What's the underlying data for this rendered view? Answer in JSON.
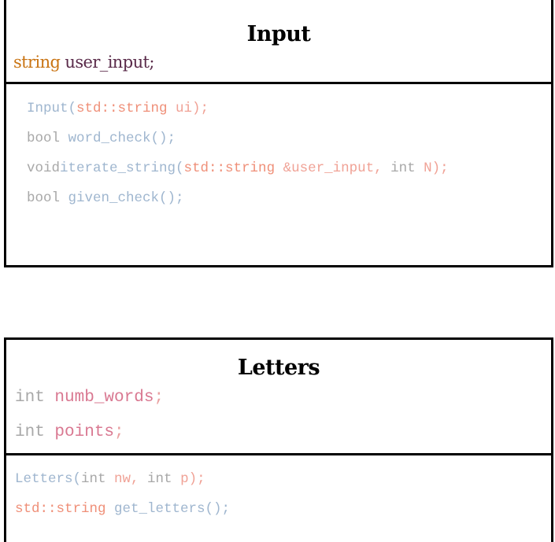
{
  "input_class": {
    "title": "Input",
    "attribute": {
      "type": "string",
      "name": "user_input;"
    },
    "methods": [
      {
        "segments": [
          {
            "text": "Input(",
            "style": "fn"
          },
          {
            "text": "std::string",
            "style": "type"
          },
          {
            "text": " ui);",
            "style": "arg"
          }
        ]
      },
      {
        "segments": [
          {
            "text": "bool",
            "style": "kw"
          },
          {
            "text": " word_check();",
            "style": "fn"
          }
        ]
      },
      {
        "segments": [
          {
            "text": "void",
            "style": "kw"
          },
          {
            "text": "iterate_string(",
            "style": "fn"
          },
          {
            "text": "std::string",
            "style": "type"
          },
          {
            "text": " &user_input, ",
            "style": "arg"
          },
          {
            "text": "int",
            "style": "kw"
          },
          {
            "text": " N);",
            "style": "arg"
          }
        ]
      },
      {
        "segments": [
          {
            "text": "bool",
            "style": "kw"
          },
          {
            "text": " given_check();",
            "style": "fn"
          }
        ]
      }
    ]
  },
  "letters_class": {
    "title": "Letters",
    "attributes": [
      {
        "segments": [
          {
            "text": "int",
            "style": "kw"
          },
          {
            "text": " numb_words",
            "style": "fieldname"
          },
          {
            "text": ";",
            "style": "punct"
          }
        ]
      },
      {
        "segments": [
          {
            "text": "int",
            "style": "kw"
          },
          {
            "text": " points",
            "style": "fieldname"
          },
          {
            "text": ";",
            "style": "punct"
          }
        ]
      }
    ],
    "methods": [
      {
        "segments": [
          {
            "text": "Letters(",
            "style": "fn"
          },
          {
            "text": "int",
            "style": "kw"
          },
          {
            "text": " nw, ",
            "style": "arg"
          },
          {
            "text": "int",
            "style": "kw"
          },
          {
            "text": " p);",
            "style": "arg"
          }
        ]
      },
      {
        "segments": [
          {
            "text": "std::string",
            "style": "type"
          },
          {
            "text": " get_letters();",
            "style": "fn"
          }
        ]
      }
    ]
  },
  "colors": {
    "border": "#000000",
    "function_name": "#9fb6cf",
    "keyword": "#a8a8a8",
    "type": "#ef8f78",
    "argument": "#f0a296",
    "field_name": "#d97891",
    "string_type": "#c97413",
    "user_variable": "#5a2b4a"
  }
}
